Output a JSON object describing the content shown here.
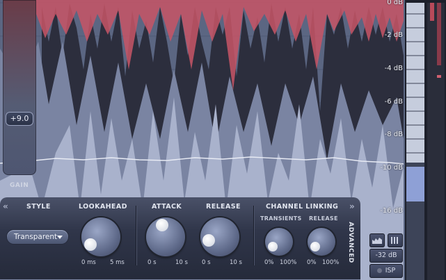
{
  "db_scale": [
    "0 dB",
    "-2 dB",
    "-4 dB",
    "-6 dB",
    "-8 dB",
    "-10 dB",
    "-16 dB"
  ],
  "gain": {
    "value": "+9.0",
    "label": "GAIN"
  },
  "panel": {
    "style": {
      "label": "STYLE",
      "value": "Transparent"
    },
    "lookahead": {
      "label": "LOOKAHEAD",
      "min": "0 ms",
      "max": "5 ms"
    },
    "attack": {
      "label": "ATTACK",
      "min": "0 s",
      "max": "10 s"
    },
    "release": {
      "label": "RELEASE",
      "min": "0 s",
      "max": "10 s"
    },
    "channel_linking": {
      "label": "CHANNEL LINKING",
      "transients": {
        "label": "TRANSIENTS",
        "min": "0%",
        "max": "100%"
      },
      "release": {
        "label": "RELEASE",
        "min": "0%",
        "max": "100%"
      }
    },
    "advanced_label": "ADVANCED"
  },
  "side_buttons": {
    "range": "-32 dB",
    "isp": "ISP"
  },
  "colors": {
    "reduction": "#c85566",
    "waveform": "#a9b2cc",
    "waveform_dim": "#7a84a2",
    "background": "#5b6682"
  }
}
